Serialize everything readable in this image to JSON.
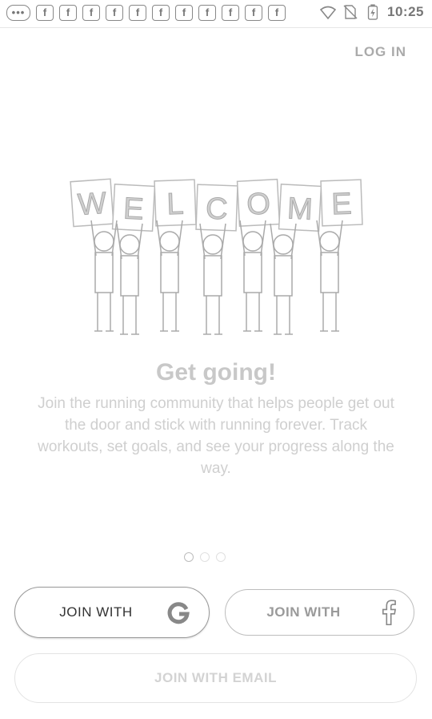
{
  "status_bar": {
    "message_icon": "message-icon",
    "facebook_notifications": [
      "f",
      "f",
      "f",
      "f",
      "f",
      "f",
      "f",
      "f",
      "f",
      "f",
      "f"
    ],
    "time": "10:25"
  },
  "header": {
    "login_label": "LOG IN"
  },
  "hero": {
    "sign_letters": [
      "W",
      "E",
      "L",
      "C",
      "O",
      "M",
      "E"
    ]
  },
  "content": {
    "title": "Get going!",
    "description": "Join the running community that helps people get out the door and stick with running forever. Track workouts, set goals, and see your progress along the way."
  },
  "pager": {
    "count": 3,
    "active_index": 0
  },
  "buttons": {
    "google_label": "JOIN WITH",
    "google_icon": "google-icon",
    "facebook_label": "JOIN WITH",
    "facebook_icon": "facebook-icon",
    "email_label": "JOIN WITH EMAIL"
  }
}
